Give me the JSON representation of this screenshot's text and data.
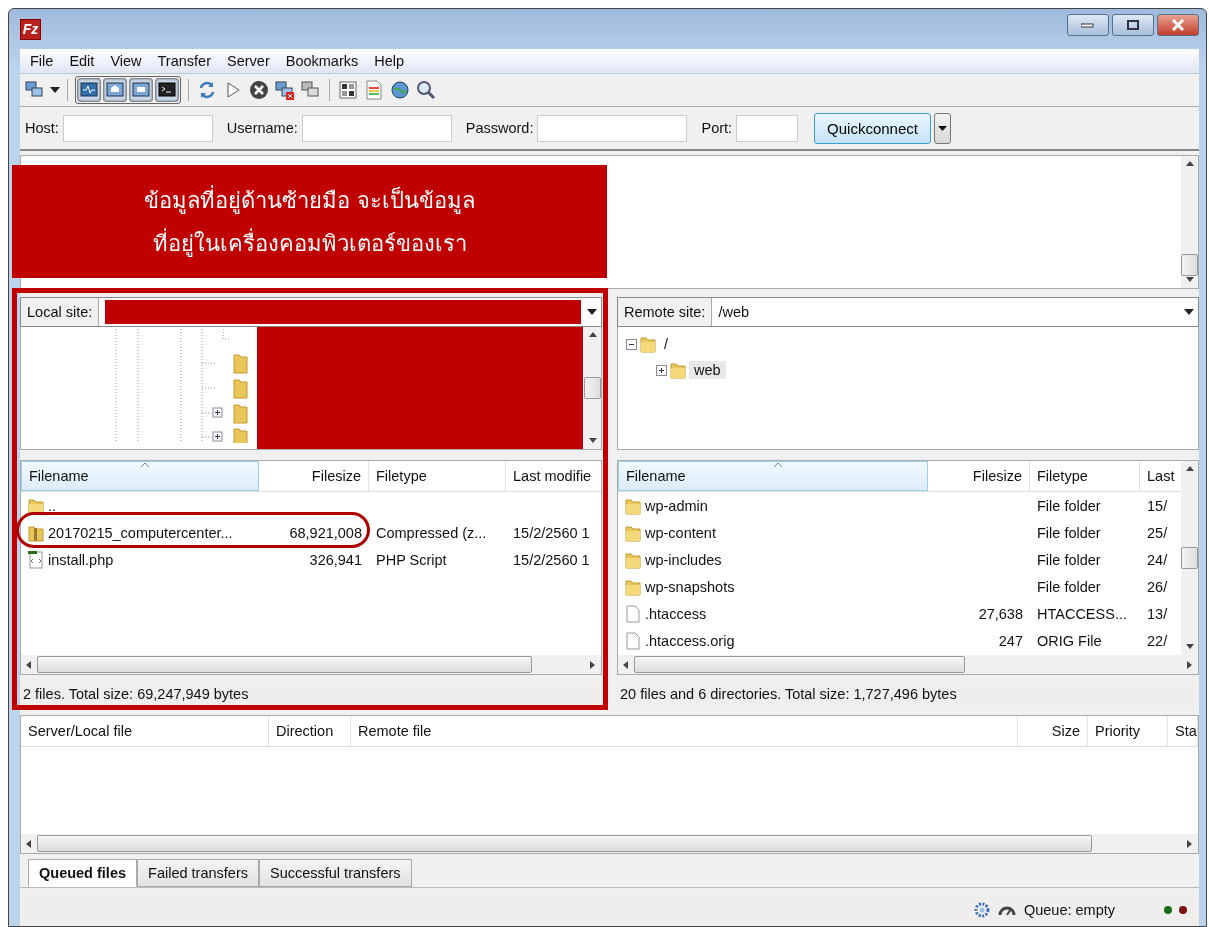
{
  "window": {
    "logo": "Fz"
  },
  "menu": [
    "File",
    "Edit",
    "View",
    "Transfer",
    "Server",
    "Bookmarks",
    "Help"
  ],
  "toolbar": {
    "toggles": [
      {
        "kind": "log",
        "on": true
      },
      {
        "kind": "local-tree",
        "on": true
      },
      {
        "kind": "remote-tree",
        "on": true
      },
      {
        "kind": "queue",
        "on": true
      }
    ]
  },
  "quickconnect": {
    "fields": [
      {
        "label": "Host:",
        "kind": "wide"
      },
      {
        "label": "Username:",
        "kind": "wide"
      },
      {
        "label": "Password:",
        "kind": "wide"
      },
      {
        "label": "Port:",
        "kind": "narrow"
      }
    ],
    "button": "Quickconnect"
  },
  "annotation": {
    "lines": [
      "ข้อมูลที่อยู่ด้านซ้ายมือ จะเป็นข้อมูล",
      "ที่อยู่ในเครื่องคอมพิวเตอร์ของเรา"
    ]
  },
  "local": {
    "site_label": "Local site:",
    "columns": [
      {
        "label": "Filename",
        "sorted": true
      },
      {
        "label": "Filesize",
        "sorted": false
      },
      {
        "label": "Filetype",
        "sorted": false
      },
      {
        "label": "Last modifie",
        "sorted": false
      }
    ],
    "rows": [
      {
        "kind": "folder",
        "name": "..",
        "size": "",
        "type": "",
        "modified": ""
      },
      {
        "kind": "archive",
        "name": "20170215_computercenter...",
        "size": "68,921,008",
        "type": "Compressed (z...",
        "modified": "15/2/2560 1"
      },
      {
        "kind": "php",
        "name": "install.php",
        "size": "326,941",
        "type": "PHP Script",
        "modified": "15/2/2560 1"
      }
    ],
    "status": "2 files. Total size: 69,247,949 bytes"
  },
  "remote": {
    "site_label": "Remote site:",
    "path": "/web",
    "tree": [
      {
        "label": "/",
        "expanded": true,
        "selected": false,
        "children": [
          {
            "label": "web",
            "expanded": false,
            "selected": true
          }
        ]
      }
    ],
    "columns": [
      {
        "label": "Filename",
        "sorted": true
      },
      {
        "label": "Filesize",
        "sorted": false
      },
      {
        "label": "Filetype",
        "sorted": false
      },
      {
        "label": "Last",
        "sorted": false
      }
    ],
    "rows": [
      {
        "kind": "folder",
        "name": "wp-admin",
        "size": "",
        "type": "File folder",
        "modified": "15/"
      },
      {
        "kind": "folder",
        "name": "wp-content",
        "size": "",
        "type": "File folder",
        "modified": "25/"
      },
      {
        "kind": "folder",
        "name": "wp-includes",
        "size": "",
        "type": "File folder",
        "modified": "24/"
      },
      {
        "kind": "folder",
        "name": "wp-snapshots",
        "size": "",
        "type": "File folder",
        "modified": "26/"
      },
      {
        "kind": "file",
        "name": ".htaccess",
        "size": "27,638",
        "type": "HTACCESS...",
        "modified": "13/"
      },
      {
        "kind": "file",
        "name": ".htaccess.orig",
        "size": "247",
        "type": "ORIG File",
        "modified": "22/"
      }
    ],
    "status": "20 files and 6 directories. Total size: 1,727,496 bytes"
  },
  "queue": {
    "columns": [
      "Server/Local file",
      "Direction",
      "Remote file",
      "Size",
      "Priority",
      "Sta"
    ],
    "tabs": [
      {
        "label": "Queued files",
        "selected": true
      },
      {
        "label": "Failed transfers",
        "selected": false
      },
      {
        "label": "Successful transfers",
        "selected": false
      }
    ]
  },
  "status_bar": {
    "queue": "Queue: empty"
  }
}
